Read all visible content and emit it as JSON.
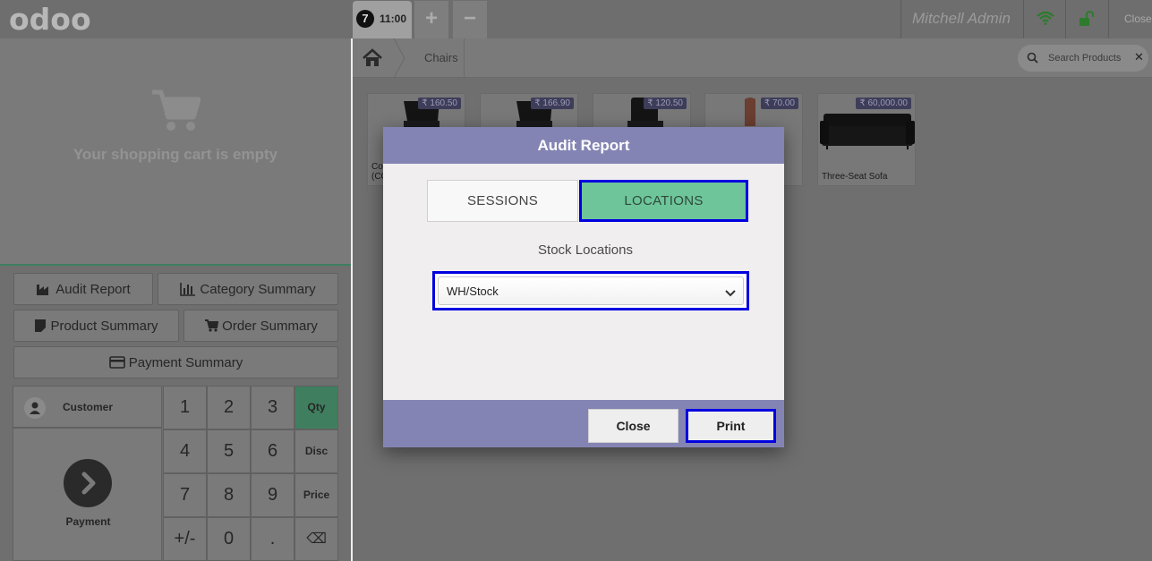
{
  "topbar": {
    "logo": "odoo",
    "order_number": "7",
    "order_time": "11:00",
    "add_label": "+",
    "remove_label": "−",
    "username": "Mitchell Admin",
    "close_label": "Close"
  },
  "cart": {
    "empty_message": "Your shopping cart is empty"
  },
  "control_buttons": {
    "audit_report": "Audit Report",
    "category_summary": "Category Summary",
    "product_summary": "Product Summary",
    "order_summary": "Order Summary",
    "payment_summary": "Payment Summary"
  },
  "actionpad": {
    "customer": "Customer",
    "payment": "Payment"
  },
  "numpad": {
    "k1": "1",
    "k2": "2",
    "k3": "3",
    "qty": "Qty",
    "k4": "4",
    "k5": "5",
    "k6": "6",
    "disc": "Disc",
    "k7": "7",
    "k8": "8",
    "k9": "9",
    "price": "Price",
    "sign": "+/-",
    "k0": "0",
    "dot": ".",
    "backspace": "⌫"
  },
  "breadcrumb": {
    "category": "Chairs"
  },
  "search": {
    "placeholder": "Search Products"
  },
  "products": [
    {
      "price": "₹ 160.50",
      "name": "Co\n(CC"
    },
    {
      "price": "₹ 166.90",
      "name": ""
    },
    {
      "price": "₹ 120.50",
      "name": ""
    },
    {
      "price": "₹ 70.00",
      "name": ""
    },
    {
      "price": "₹ 60,000.00",
      "name": "Three-Seat Sofa"
    }
  ],
  "modal": {
    "title": "Audit Report",
    "tab_sessions": "SESSIONS",
    "tab_locations": "LOCATIONS",
    "stock_label": "Stock Locations",
    "selected_location": "WH/Stock",
    "close_button": "Close",
    "print_button": "Print"
  },
  "colors": {
    "modal_header": "#8484b4",
    "active_tab": "#6ec59a",
    "highlight_border": "#0000e0",
    "qty_active": "#3f7f5f"
  }
}
